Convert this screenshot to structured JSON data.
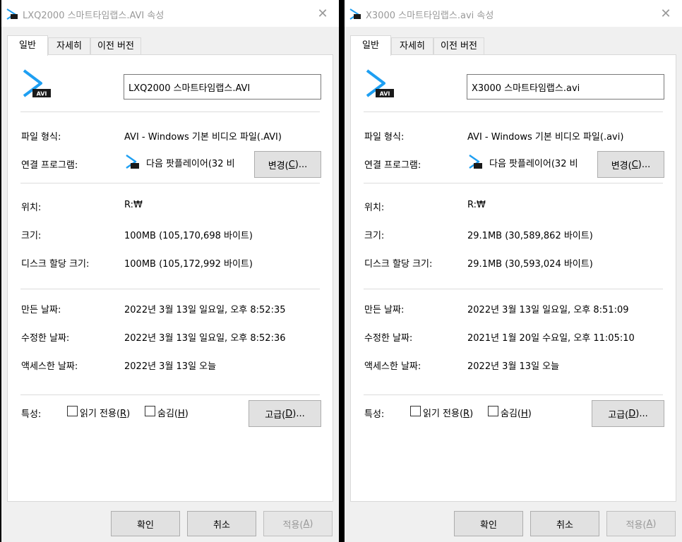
{
  "dialogs": [
    {
      "title": "LXQ2000 스마트타임랩스.AVI 속성",
      "tabs": [
        "일반",
        "자세히",
        "이전 버전"
      ],
      "filename": "LXQ2000 스마트타임랩스.AVI",
      "icon_badge": "AVI",
      "file_type_label": "파일 형식:",
      "file_type_value": "AVI - Windows 기본 비디오 파일(.AVI)",
      "opens_with_label": "연결 프로그램:",
      "opens_with_value": "다음 팟플레이어(32 비",
      "change_label": "변경(",
      "change_key": "C",
      "change_tail": ")...",
      "location_label": "위치:",
      "location_value": "R:₩",
      "size_label": "크기:",
      "size_value": "100MB (105,170,698 바이트)",
      "disk_label": "디스크 할당 크기:",
      "disk_value": "100MB (105,172,992 바이트)",
      "created_label": "만든 날짜:",
      "created_value": "2022년 3월 13일 일요일, 오후 8:52:35",
      "modified_label": "수정한 날짜:",
      "modified_value": "2022년 3월 13일 일요일, 오후 8:52:36",
      "accessed_label": "액세스한 날짜:",
      "accessed_value": "2022년 3월 13일 오늘",
      "attributes_label": "특성:",
      "readonly_label": "읽기 전용(",
      "readonly_key": "R",
      "readonly_tail": ")",
      "hidden_label": "숨김(",
      "hidden_key": "H",
      "hidden_tail": ")",
      "advanced_label": "고급(",
      "advanced_key": "D",
      "advanced_tail": ")...",
      "ok_label": "확인",
      "cancel_label": "취소",
      "apply_label": "적용(",
      "apply_key": "A",
      "apply_tail": ")"
    },
    {
      "title": "X3000 스마트타임랩스.avi 속성",
      "tabs": [
        "일반",
        "자세히",
        "이전 버전"
      ],
      "filename": "X3000 스마트타임랩스.avi",
      "icon_badge": "AVI",
      "file_type_label": "파일 형식:",
      "file_type_value": "AVI - Windows 기본 비디오 파일(.avi)",
      "opens_with_label": "연결 프로그램:",
      "opens_with_value": "다음 팟플레이어(32 비",
      "change_label": "변경(",
      "change_key": "C",
      "change_tail": ")...",
      "location_label": "위치:",
      "location_value": "R:₩",
      "size_label": "크기:",
      "size_value": "29.1MB (30,589,862 바이트)",
      "disk_label": "디스크 할당 크기:",
      "disk_value": "29.1MB (30,593,024 바이트)",
      "created_label": "만든 날짜:",
      "created_value": "2022년 3월 13일 일요일, 오후 8:51:09",
      "modified_label": "수정한 날짜:",
      "modified_value": "2021년 1월 20일 수요일, 오후 11:05:10",
      "accessed_label": "액세스한 날짜:",
      "accessed_value": "2022년 3월 13일 오늘",
      "attributes_label": "특성:",
      "readonly_label": "읽기 전용(",
      "readonly_key": "R",
      "readonly_tail": ")",
      "hidden_label": "숨김(",
      "hidden_key": "H",
      "hidden_tail": ")",
      "advanced_label": "고급(",
      "advanced_key": "D",
      "advanced_tail": ")...",
      "ok_label": "확인",
      "cancel_label": "취소",
      "apply_label": "적용(",
      "apply_key": "A",
      "apply_tail": ")"
    }
  ],
  "colors": {
    "icon_blue": "#1e9ff2",
    "badge_dark": "#1a1a1a",
    "disabled_text": "#999999"
  }
}
